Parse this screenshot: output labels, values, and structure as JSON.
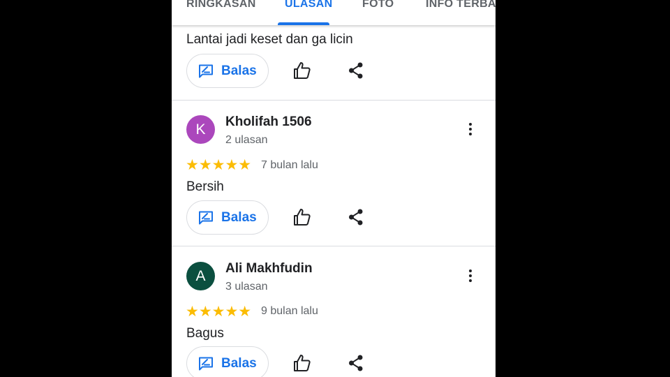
{
  "tabs": [
    {
      "label": "RINGKASAN",
      "active": false
    },
    {
      "label": "ULASAN",
      "active": true
    },
    {
      "label": "FOTO",
      "active": false
    },
    {
      "label": "INFO TERBA",
      "active": false
    }
  ],
  "colors": {
    "accent": "#1a73e8",
    "star": "#fbbc04"
  },
  "reply_label": "Balas",
  "first_review_text": "Lantai jadi keset dan ga licin",
  "reviews": [
    {
      "avatar_letter": "K",
      "avatar_color": "#ab47bc",
      "name": "Kholifah 1506",
      "count": "2 ulasan",
      "rating": 5,
      "stars": "★★★★★",
      "time": "7 bulan lalu",
      "text": "Bersih"
    },
    {
      "avatar_letter": "A",
      "avatar_color": "#0b4f3f",
      "name": "Ali Makhfudin",
      "count": "3 ulasan",
      "rating": 5,
      "stars": "★★★★★",
      "time": "9 bulan lalu",
      "text": "Bagus"
    }
  ]
}
